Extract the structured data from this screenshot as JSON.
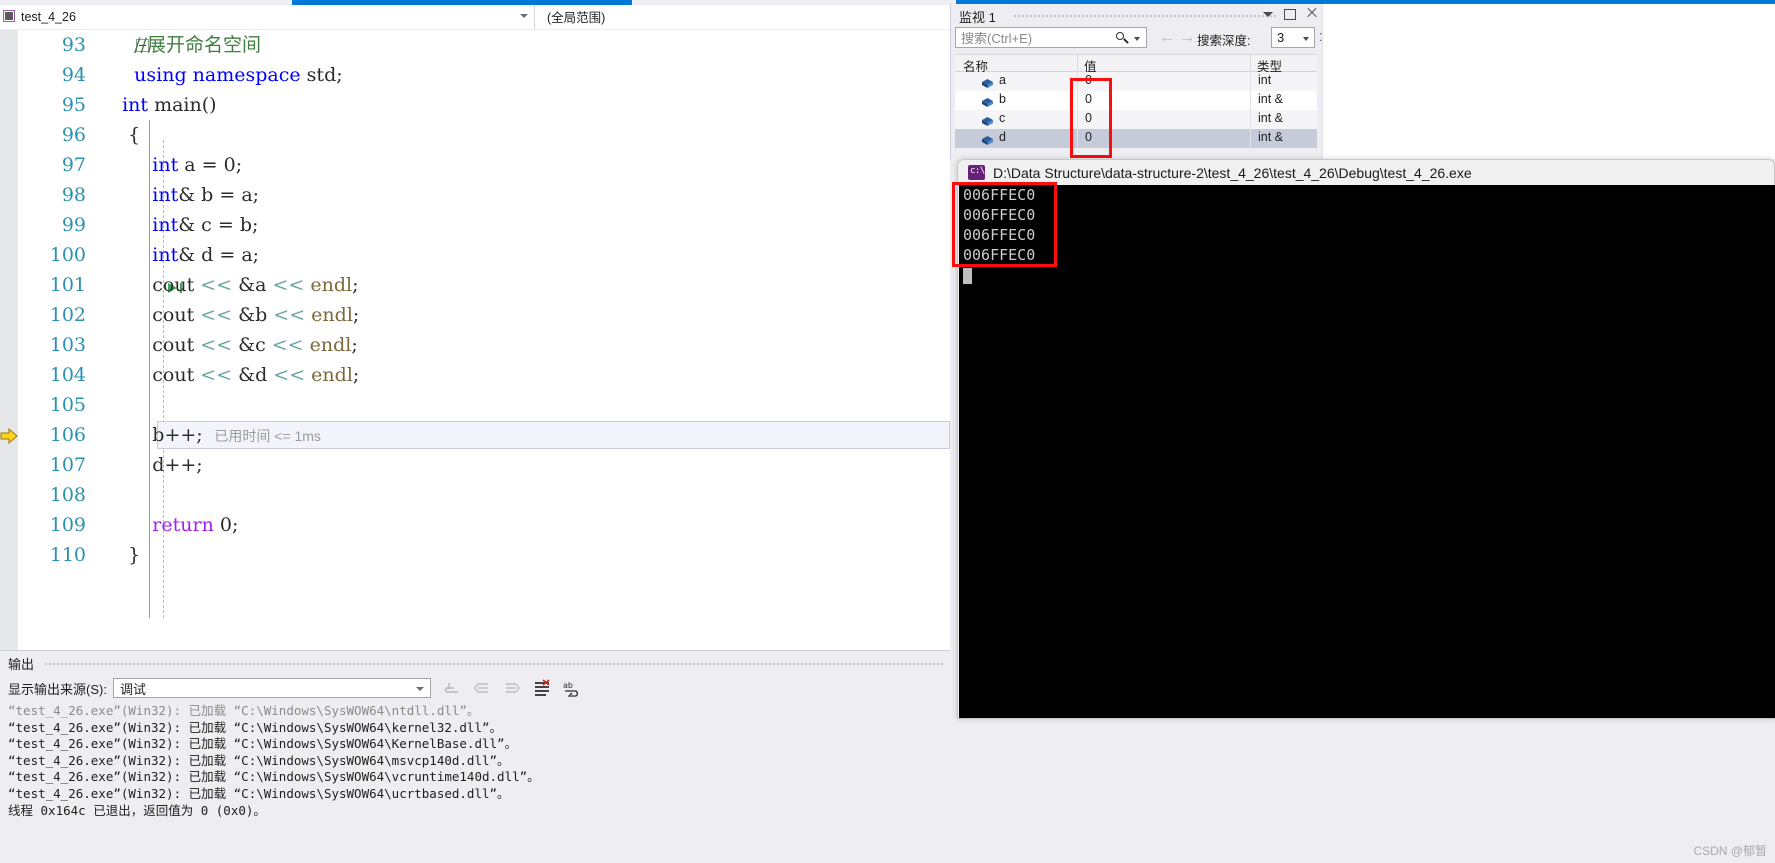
{
  "navbar": {
    "project_name": "test_4_26",
    "scope": "(全局范围)",
    "project_icon": "project-icon",
    "caret_icon": "chevron-down-icon"
  },
  "editor": {
    "lines": [
      {
        "num": "93",
        "segments": [
          {
            "t": "    //展开命名空间",
            "c": "cmt"
          }
        ]
      },
      {
        "num": "94",
        "segments": [
          {
            "t": "    ",
            "c": "plain"
          },
          {
            "t": "using namespace",
            "c": "kw"
          },
          {
            "t": " std;",
            "c": "plain"
          }
        ]
      },
      {
        "num": "95",
        "segments": [
          {
            "t": "  ",
            "c": "plain"
          },
          {
            "t": "int",
            "c": "kw"
          },
          {
            "t": " main()",
            "c": "plain"
          }
        ]
      },
      {
        "num": "96",
        "segments": [
          {
            "t": "   {",
            "c": "plain"
          }
        ]
      },
      {
        "num": "97",
        "segments": [
          {
            "t": "       ",
            "c": "plain"
          },
          {
            "t": "int",
            "c": "kw"
          },
          {
            "t": " a = ",
            "c": "plain"
          },
          {
            "t": "0",
            "c": "num"
          },
          {
            "t": ";",
            "c": "plain"
          }
        ]
      },
      {
        "num": "98",
        "segments": [
          {
            "t": "       ",
            "c": "plain"
          },
          {
            "t": "int",
            "c": "kw"
          },
          {
            "t": "& b = a;",
            "c": "plain"
          }
        ]
      },
      {
        "num": "99",
        "segments": [
          {
            "t": "       ",
            "c": "plain"
          },
          {
            "t": "int",
            "c": "kw"
          },
          {
            "t": "& c = b;",
            "c": "plain"
          }
        ]
      },
      {
        "num": "100",
        "segments": [
          {
            "t": "       ",
            "c": "plain"
          },
          {
            "t": "int",
            "c": "kw"
          },
          {
            "t": "& d = a;",
            "c": "plain"
          }
        ]
      },
      {
        "num": "101",
        "segments": [
          {
            "t": "       cout ",
            "c": "plain"
          },
          {
            "t": "<<",
            "c": "op-green"
          },
          {
            "t": " &a ",
            "c": "plain"
          },
          {
            "t": "<<",
            "c": "op-green"
          },
          {
            "t": " ",
            "c": "plain"
          },
          {
            "t": "endl",
            "c": "endl"
          },
          {
            "t": ";",
            "c": "plain"
          }
        ]
      },
      {
        "num": "102",
        "segments": [
          {
            "t": "       cout ",
            "c": "plain"
          },
          {
            "t": "<<",
            "c": "op-green"
          },
          {
            "t": " &b ",
            "c": "plain"
          },
          {
            "t": "<<",
            "c": "op-green"
          },
          {
            "t": " ",
            "c": "plain"
          },
          {
            "t": "endl",
            "c": "endl"
          },
          {
            "t": ";",
            "c": "plain"
          }
        ]
      },
      {
        "num": "103",
        "segments": [
          {
            "t": "       cout ",
            "c": "plain"
          },
          {
            "t": "<<",
            "c": "op-green"
          },
          {
            "t": " &c ",
            "c": "plain"
          },
          {
            "t": "<<",
            "c": "op-green"
          },
          {
            "t": " ",
            "c": "plain"
          },
          {
            "t": "endl",
            "c": "endl"
          },
          {
            "t": ";",
            "c": "plain"
          }
        ]
      },
      {
        "num": "104",
        "segments": [
          {
            "t": "       cout ",
            "c": "plain"
          },
          {
            "t": "<<",
            "c": "op-green"
          },
          {
            "t": " &d ",
            "c": "plain"
          },
          {
            "t": "<<",
            "c": "op-green"
          },
          {
            "t": " ",
            "c": "plain"
          },
          {
            "t": "endl",
            "c": "endl"
          },
          {
            "t": ";",
            "c": "plain"
          }
        ]
      },
      {
        "num": "105",
        "segments": [
          {
            "t": "",
            "c": "plain"
          }
        ]
      },
      {
        "num": "106",
        "segments": [
          {
            "t": "       b++;",
            "c": "plain"
          }
        ]
      },
      {
        "num": "107",
        "segments": [
          {
            "t": "       d++;",
            "c": "plain"
          }
        ]
      },
      {
        "num": "108",
        "segments": [
          {
            "t": "",
            "c": "plain"
          }
        ]
      },
      {
        "num": "109",
        "segments": [
          {
            "t": "       ",
            "c": "plain"
          },
          {
            "t": "return",
            "c": "kw-purple"
          },
          {
            "t": " ",
            "c": "plain"
          },
          {
            "t": "0",
            "c": "num"
          },
          {
            "t": ";",
            "c": "plain"
          }
        ]
      },
      {
        "num": "110",
        "segments": [
          {
            "t": "   }",
            "c": "plain"
          }
        ]
      }
    ],
    "elapsed_tooltip": "已用时间 <= 1ms",
    "current_line_number": "106",
    "breakpoint_line_number": "101"
  },
  "watch": {
    "title": "监视 1",
    "search_placeholder": "搜索(Ctrl+E)",
    "depth_label": "搜索深度:",
    "depth_value": "3",
    "columns": [
      "名称",
      "值",
      "类型"
    ],
    "rows": [
      {
        "name": "a",
        "value": "0",
        "type": "int"
      },
      {
        "name": "b",
        "value": "0",
        "type": "int &"
      },
      {
        "name": "c",
        "value": "0",
        "type": "int &"
      },
      {
        "name": "d",
        "value": "0",
        "type": "int &"
      }
    ],
    "window_buttons": [
      "chevron-down-icon",
      "maximize-icon",
      "close-icon"
    ]
  },
  "console": {
    "title": "D:\\Data Structure\\data-structure-2\\test_4_26\\test_4_26\\Debug\\test_4_26.exe",
    "lines": [
      "006FFEC0",
      "006FFEC0",
      "006FFEC0",
      "006FFEC0"
    ]
  },
  "output": {
    "title": "输出",
    "source_label": "显示输出来源(S):",
    "source_value": "调试",
    "log_lines": [
      "“test_4_26.exe”(Win32): 已加载 “C:\\Windows\\SysWOW64\\ntdll.dll”。",
      "“test_4_26.exe”(Win32): 已加载 “C:\\Windows\\SysWOW64\\kernel32.dll”。",
      "“test_4_26.exe”(Win32): 已加载 “C:\\Windows\\SysWOW64\\KernelBase.dll”。",
      "“test_4_26.exe”(Win32): 已加载 “C:\\Windows\\SysWOW64\\msvcp140d.dll”。",
      "“test_4_26.exe”(Win32): 已加载 “C:\\Windows\\SysWOW64\\vcruntime140d.dll”。",
      "“test_4_26.exe”(Win32): 已加载 “C:\\Windows\\SysWOW64\\ucrtbased.dll”。",
      "线程 0x164c 已退出，返回值为 0 (0x0)。"
    ]
  },
  "watermark": "CSDN @郁暂",
  "colors": {
    "accent": "#0078d7",
    "annotation": "#fd0d0d",
    "keyword": "#0000ff",
    "comment": "#3f7f3f",
    "line_number": "#2b91af",
    "console_bg": "#000000"
  }
}
